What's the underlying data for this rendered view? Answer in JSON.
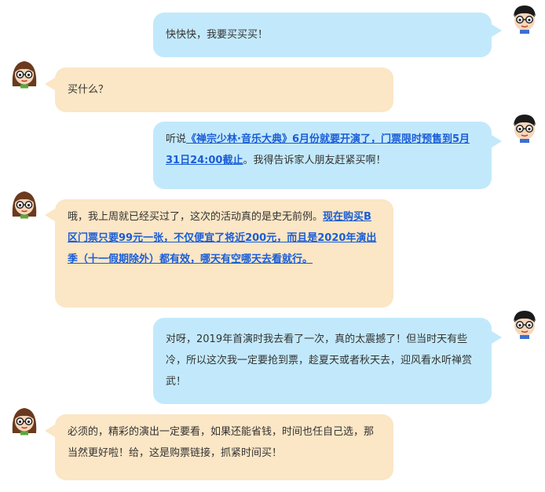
{
  "colors": {
    "user_bubble": "#c2e9fb",
    "agent_bubble": "#fbe6c5",
    "link": "#1a5dd6",
    "text": "#333333"
  },
  "messages": [
    {
      "sender": "user",
      "avatar": "boy-avatar-icon",
      "segments": [
        {
          "text": "快快快，我要买买买！",
          "link": false
        }
      ]
    },
    {
      "sender": "agent",
      "avatar": "girl-avatar-icon",
      "segments": [
        {
          "text": "买什么？",
          "link": false
        }
      ]
    },
    {
      "sender": "user",
      "avatar": "boy-avatar-icon",
      "segments": [
        {
          "text": "听说",
          "link": false
        },
        {
          "text": "《禅宗少林·音乐大典》6月份就要开演了，门票限时预售到5月31日24:00截止",
          "link": true
        },
        {
          "text": "。我得告诉家人朋友赶紧买啊！",
          "link": false
        }
      ]
    },
    {
      "sender": "agent",
      "avatar": "girl-avatar-icon",
      "segments": [
        {
          "text": "哦，我上周就已经买过了，这次的活动真的是史无前例。",
          "link": false
        },
        {
          "text": "现在购买B区门票只要99元一张，不仅便宜了将近200元，而且是2020年演出季（十一假期除外）都有效，哪天有空哪天去看就行。",
          "link": true
        }
      ]
    },
    {
      "sender": "user",
      "avatar": "boy-avatar-icon",
      "segments": [
        {
          "text": "对呀，2019年首演时我去看了一次，真的太震撼了！但当时天有些冷，所以这次我一定要抢到票，趁夏天或者秋天去，迎风看水听禅赏武！",
          "link": false
        }
      ]
    },
    {
      "sender": "agent",
      "avatar": "girl-avatar-icon",
      "segments": [
        {
          "text": "必须的，精彩的演出一定要看，如果还能省钱，时间也任自己选，那当然更好啦！给，这是购票链接，抓紧时间买！",
          "link": false
        }
      ]
    }
  ]
}
